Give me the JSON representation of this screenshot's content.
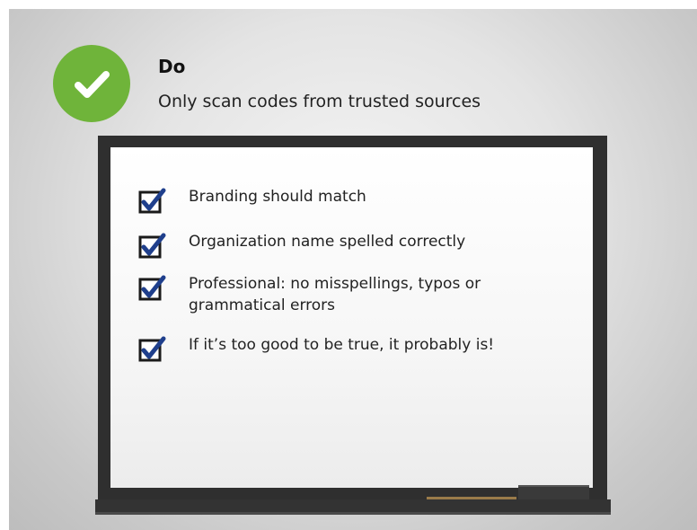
{
  "slide": {
    "heading": "Do",
    "subheading": "Only scan codes from trusted sources",
    "badge_icon": "check-circle-icon",
    "accent_color": "#6fb43a",
    "checkbox_color": "#1f3f8c"
  },
  "board": {
    "items": [
      {
        "label": "Branding should match",
        "icon": "checkbox-checked-icon"
      },
      {
        "label": "Organization name spelled correctly",
        "icon": "checkbox-checked-icon"
      },
      {
        "label": "Professional: no misspellings, typos or grammatical errors",
        "icon": "checkbox-checked-icon"
      },
      {
        "label": "If it’s too good to be true, it probably is!",
        "icon": "checkbox-checked-icon"
      }
    ]
  }
}
